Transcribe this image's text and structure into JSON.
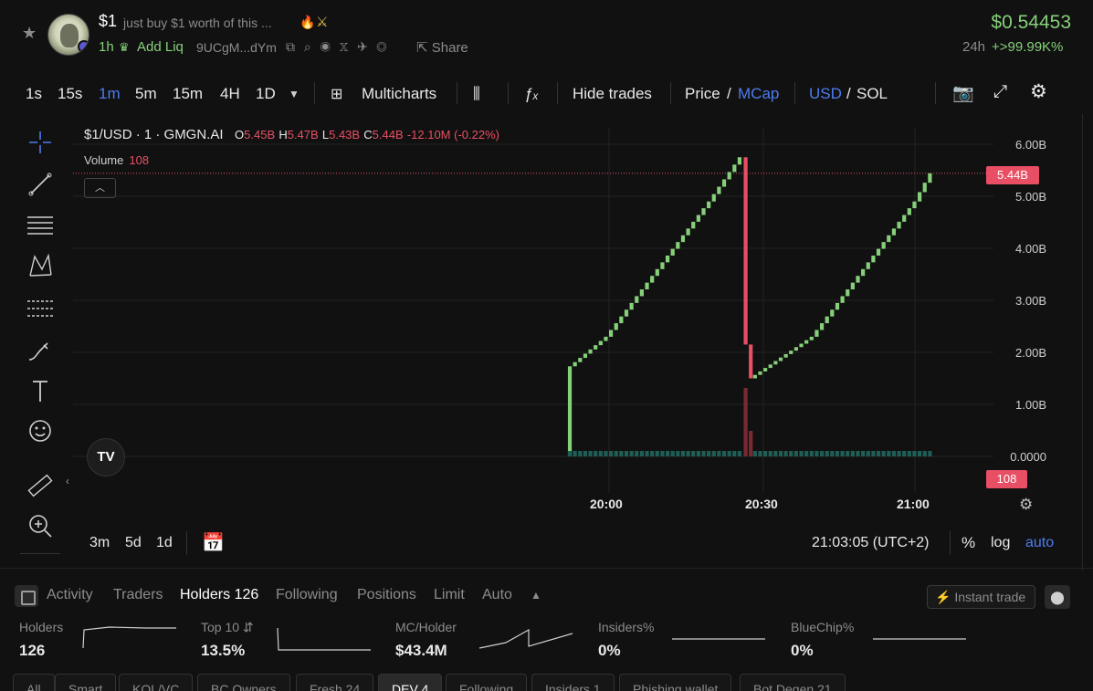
{
  "header": {
    "token_symbol": "$1",
    "token_description": "just buy $1 worth of this ...",
    "age": "1h",
    "add_liquidity": "Add Liq",
    "address": "9UCgM...dYm",
    "share_label": "Share",
    "price": "$0.54453",
    "change_period": "24h",
    "change_value": "+>99.99K%"
  },
  "toolbar": {
    "intervals": [
      "1s",
      "15s",
      "1m",
      "5m",
      "15m",
      "4H",
      "1D"
    ],
    "active_interval": "1m",
    "multicharts_label": "Multicharts",
    "hide_trades_label": "Hide trades",
    "price_label": "Price",
    "slash": "/",
    "mcap_label": "MCap",
    "usd_label": "USD",
    "sol_label": "SOL"
  },
  "chart_legend": {
    "symbol": "$1/USD · 1 · GMGN.AI",
    "open_key": "O",
    "open": "5.45B",
    "high_key": "H",
    "high": "5.47B",
    "low_key": "L",
    "low": "5.43B",
    "close_key": "C",
    "close": "5.44B",
    "change": "-12.10M (-0.22%)",
    "volume_label": "Volume",
    "volume_value": "108"
  },
  "chart_data": {
    "type": "candlestick",
    "y_ticks": [
      "6.00B",
      "5.00B",
      "4.00B",
      "3.00B",
      "2.00B",
      "1.00B",
      "0.0000"
    ],
    "x_ticks": [
      "20:00",
      "20:30",
      "21:00"
    ],
    "ylim": [
      0,
      6
    ],
    "current_price_tag": "5.44B",
    "volume_tag": "108",
    "market_cap_series_billions": [
      {
        "time": "19:52",
        "value": 0.0
      },
      {
        "time": "19:52",
        "value": 1.65
      },
      {
        "time": "20:00",
        "value": 2.3
      },
      {
        "time": "20:10",
        "value": 3.6
      },
      {
        "time": "20:20",
        "value": 4.9
      },
      {
        "time": "20:26",
        "value": 5.75
      },
      {
        "time": "20:27",
        "value": 2.15
      },
      {
        "time": "20:28",
        "value": 1.5
      },
      {
        "time": "20:40",
        "value": 2.3
      },
      {
        "time": "20:50",
        "value": 3.6
      },
      {
        "time": "21:00",
        "value": 4.9
      },
      {
        "time": "21:03",
        "value": 5.44
      }
    ]
  },
  "range_bar": {
    "ranges": [
      "3m",
      "5d",
      "1d"
    ],
    "time": "21:03:05 (UTC+2)",
    "percent": "%",
    "log": "log",
    "auto": "auto"
  },
  "tabs": {
    "items": [
      "Activity",
      "Traders",
      "Holders 126",
      "Following",
      "Positions",
      "Limit",
      "Auto"
    ],
    "active": "Holders 126",
    "instant_trade": "Instant trade"
  },
  "stats": [
    {
      "label": "Holders",
      "value": "126"
    },
    {
      "label": "Top 10",
      "value": "13.5%"
    },
    {
      "label": "MC/Holder",
      "value": "$43.4M"
    },
    {
      "label": "Insiders%",
      "value": "0%"
    },
    {
      "label": "BlueChip%",
      "value": "0%"
    }
  ],
  "filters": {
    "items": [
      "All",
      "Smart",
      "KOL/VC",
      "BC Owners",
      "Fresh 24",
      "DEV 4",
      "Following",
      "Insiders 1",
      "Phishing wallet",
      "Bot Degen 21"
    ],
    "active": "DEV 4"
  },
  "colors": {
    "up": "#86d07a",
    "down": "#e94f64",
    "accent": "#4e7cf0",
    "background": "#111111"
  }
}
